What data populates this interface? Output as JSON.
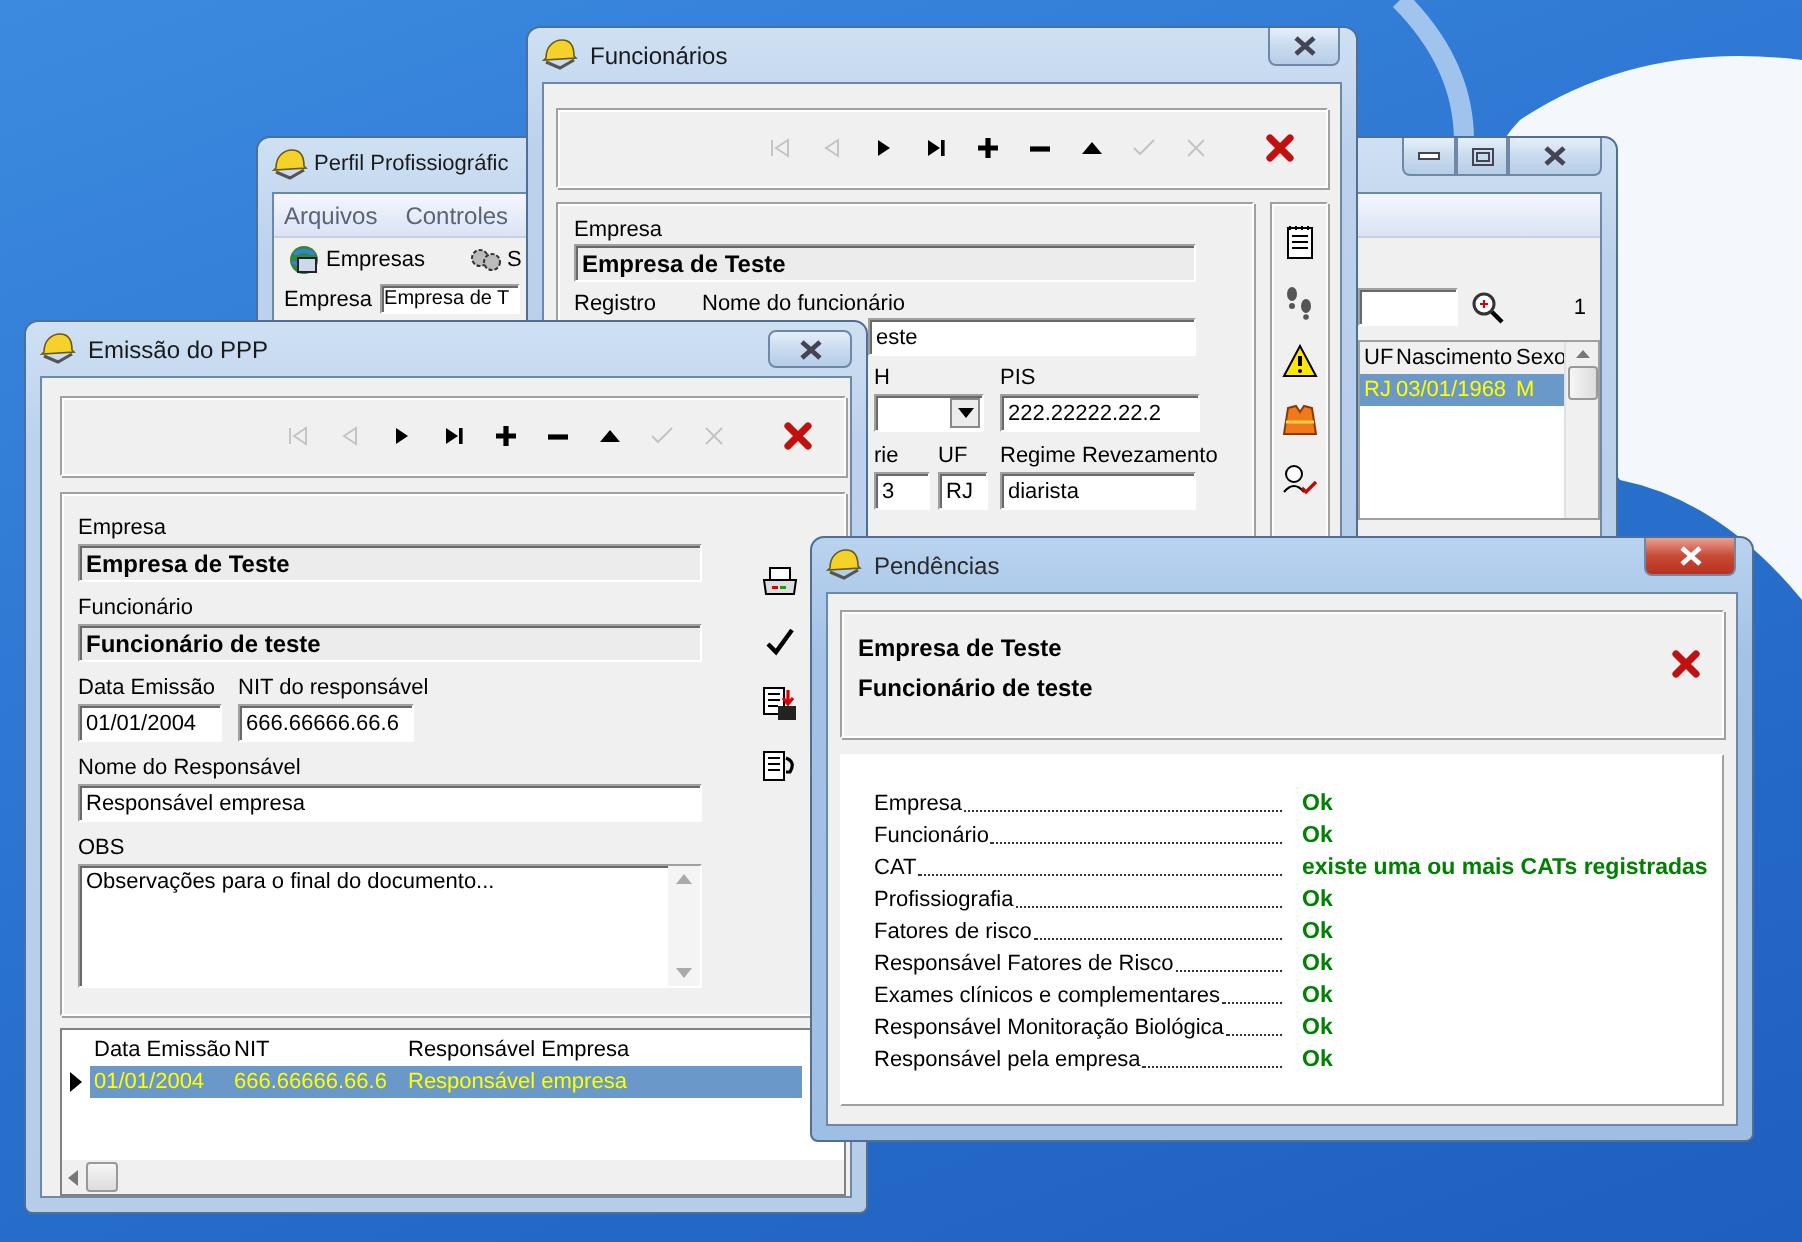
{
  "perfil_window": {
    "title": "Perfil Profissiográfic",
    "menu": [
      "Arquivos",
      "Controles"
    ],
    "toolbar": [
      "Empresas",
      "S"
    ],
    "empresa_label": "Empresa",
    "empresa_value": "Empresa de T",
    "count": "1",
    "grid": {
      "columns": [
        "UF",
        "Nascimento",
        "Sexo"
      ],
      "rows": [
        {
          "cells": [
            "RJ",
            "03/01/1968",
            "M"
          ],
          "selected": true
        }
      ]
    }
  },
  "funcionarios_window": {
    "title": "Funcionários",
    "nav_buttons": [
      {
        "kind": "first",
        "disabled": true
      },
      {
        "kind": "prior",
        "disabled": true
      },
      {
        "kind": "next",
        "disabled": false
      },
      {
        "kind": "last",
        "disabled": false
      },
      {
        "kind": "insert",
        "disabled": false
      },
      {
        "kind": "delete",
        "disabled": false
      },
      {
        "kind": "edit",
        "disabled": false
      },
      {
        "kind": "post",
        "disabled": true
      },
      {
        "kind": "cancel",
        "disabled": true
      },
      {
        "kind": "close",
        "disabled": false
      }
    ],
    "empresa_label": "Empresa",
    "empresa_value": "Empresa de Teste",
    "registro_label": "Registro",
    "nome_label": "Nome do funcionário",
    "nome_value": "este",
    "col_label": "H",
    "pis_label": "PIS",
    "pis_value": "222.22222.22.2",
    "serie_label": "rie",
    "serie_value": "3",
    "uf_label": "UF",
    "uf_value": "RJ",
    "regime_label": "Regime Revezamento",
    "regime_value": "diarista"
  },
  "emissao_window": {
    "title": "Emissão do PPP",
    "nav_buttons": [
      {
        "kind": "first",
        "disabled": true
      },
      {
        "kind": "prior",
        "disabled": true
      },
      {
        "kind": "next",
        "disabled": false
      },
      {
        "kind": "last",
        "disabled": false
      },
      {
        "kind": "insert",
        "disabled": false
      },
      {
        "kind": "delete",
        "disabled": false
      },
      {
        "kind": "edit",
        "disabled": false
      },
      {
        "kind": "post",
        "disabled": true
      },
      {
        "kind": "cancel",
        "disabled": true
      },
      {
        "kind": "close",
        "disabled": false
      }
    ],
    "empresa_label": "Empresa",
    "empresa_value": "Empresa de Teste",
    "funcionario_label": "Funcionário",
    "funcionario_value": "Funcionário de teste",
    "data_label": "Data Emissão",
    "data_value": "01/01/2004",
    "nit_label": "NIT do responsável",
    "nit_value": "666.66666.66.6",
    "responsavel_label": "Nome do Responsável",
    "responsavel_value": "Responsável empresa",
    "obs_label": "OBS",
    "obs_value": "Observações para o final do documento...",
    "grid": {
      "columns": [
        "Data Emissão",
        "NIT",
        "Responsável Empresa"
      ],
      "rows": [
        {
          "cells": [
            "01/01/2004",
            "666.66666.66.6",
            "Responsável empresa"
          ],
          "selected": true
        }
      ]
    }
  },
  "pendencias_window": {
    "title": "Pendências",
    "header": [
      "Empresa de Teste",
      "Funcionário de teste"
    ],
    "items": [
      {
        "label": "Empresa",
        "status": "Ok"
      },
      {
        "label": "Funcionário",
        "status": "Ok"
      },
      {
        "label": "CAT",
        "status": "existe uma ou mais CATs registradas"
      },
      {
        "label": "Profissiografia",
        "status": "Ok"
      },
      {
        "label": "Fatores de risco",
        "status": "Ok"
      },
      {
        "label": "Responsável Fatores de Risco",
        "status": "Ok"
      },
      {
        "label": "Exames clínicos e complementares",
        "status": "Ok"
      },
      {
        "label": "Responsável Monitoração Biológica",
        "status": "Ok"
      },
      {
        "label": "Responsável pela empresa",
        "status": "Ok"
      }
    ]
  }
}
